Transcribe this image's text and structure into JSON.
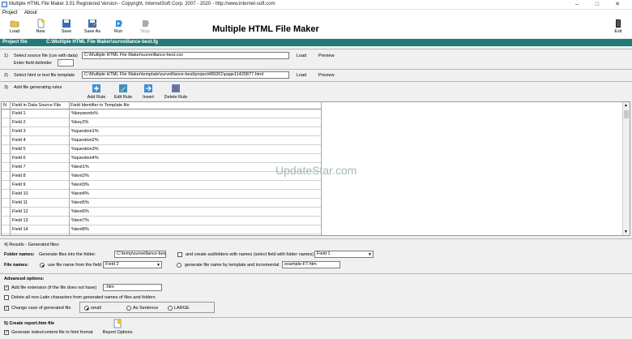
{
  "window": {
    "title": "Multiple HTML File Maker 3.01 Registered Version - Copyright, InternetSoft Corp. 2007 - 2020 - http://www.internet-soft.com"
  },
  "menu": [
    "Project",
    "About"
  ],
  "toolbar": {
    "load": "Load",
    "new": "New",
    "save": "Save",
    "save_as": "Save As",
    "run": "Run",
    "stop": "Stop",
    "exit": "Exit"
  },
  "app_title": "Multiple HTML File Maker",
  "project_bar": {
    "label": "Project file",
    "path": "C:\\Multiple HTML File Maker\\surveillance-best.fg"
  },
  "step1": {
    "num": "1)",
    "label": "Select source file (csv with data)",
    "value": "C:\\Multiple HTML File Maker\\surveillance-best.csv",
    "load": "Load",
    "preview": "Preview",
    "delim_label": "Enter field delimiter",
    "delim_value": ";"
  },
  "step2": {
    "num": "2)",
    "label": "Select html or text file template",
    "value": "C:\\Multiple HTML File Maker\\template\\surveillance-best\\project489261\\page11420877.html",
    "load": "Load",
    "preview": "Preview"
  },
  "step3": {
    "num": "3)",
    "label": "Add file generating rules",
    "add": "Add Rule",
    "edit": "Edit Rule",
    "insert": "Insert",
    "delete": "Delete Rule"
  },
  "grid": {
    "headers": [
      "N",
      "Field in Data Source File",
      "Field Identifier in Template file"
    ],
    "rows": [
      [
        "Field 1",
        "%keywords%"
      ],
      [
        "Field 2",
        "%key2%"
      ],
      [
        "Field 3",
        "%question1%"
      ],
      [
        "Field 4",
        "%question2%"
      ],
      [
        "Field 5",
        "%question3%"
      ],
      [
        "Field 6",
        "%question4%"
      ],
      [
        "Field 7",
        "%text1%"
      ],
      [
        "Field 8",
        "%text2%"
      ],
      [
        "Field 9",
        "%text3%"
      ],
      [
        "Field 10",
        "%text4%"
      ],
      [
        "Field 11",
        "%text5%"
      ],
      [
        "Field 12",
        "%text6%"
      ],
      [
        "Field 13",
        "%text7%"
      ],
      [
        "Field 14",
        "%text8%"
      ]
    ]
  },
  "watermark": "UpdateStar.com",
  "step4": {
    "title": "4)    Results - Generated files:",
    "folder_label": "Folder names:",
    "folder_text": "Generate files into the folder:",
    "folder_value": "C:\\temp\\surveillance-best\\",
    "subfolders_text": "and create subfolders with names (select field with folder names)",
    "subfolders_select": "Field 1",
    "filenames_label": "File names:",
    "use_field_text": "use file name from the field",
    "use_field_select": "Field 2",
    "generate_text": "generate file name by template and incremental",
    "generate_value": "example-F7.htm"
  },
  "advanced": {
    "title": "Advanced options:",
    "ext_text": "Add file extension (if the file does not have)",
    "ext_value": ".htm",
    "delete_text": "Delete all non-Latin characters from generated names of files and folders",
    "case_text": "Change case of generated file",
    "case_opts": [
      "small",
      "As Sentence",
      "LARGE"
    ]
  },
  "step5": {
    "title": "5)    Create report.htm file",
    "index_text": "Generate index/content file in html format",
    "report_options": "Report Options"
  }
}
